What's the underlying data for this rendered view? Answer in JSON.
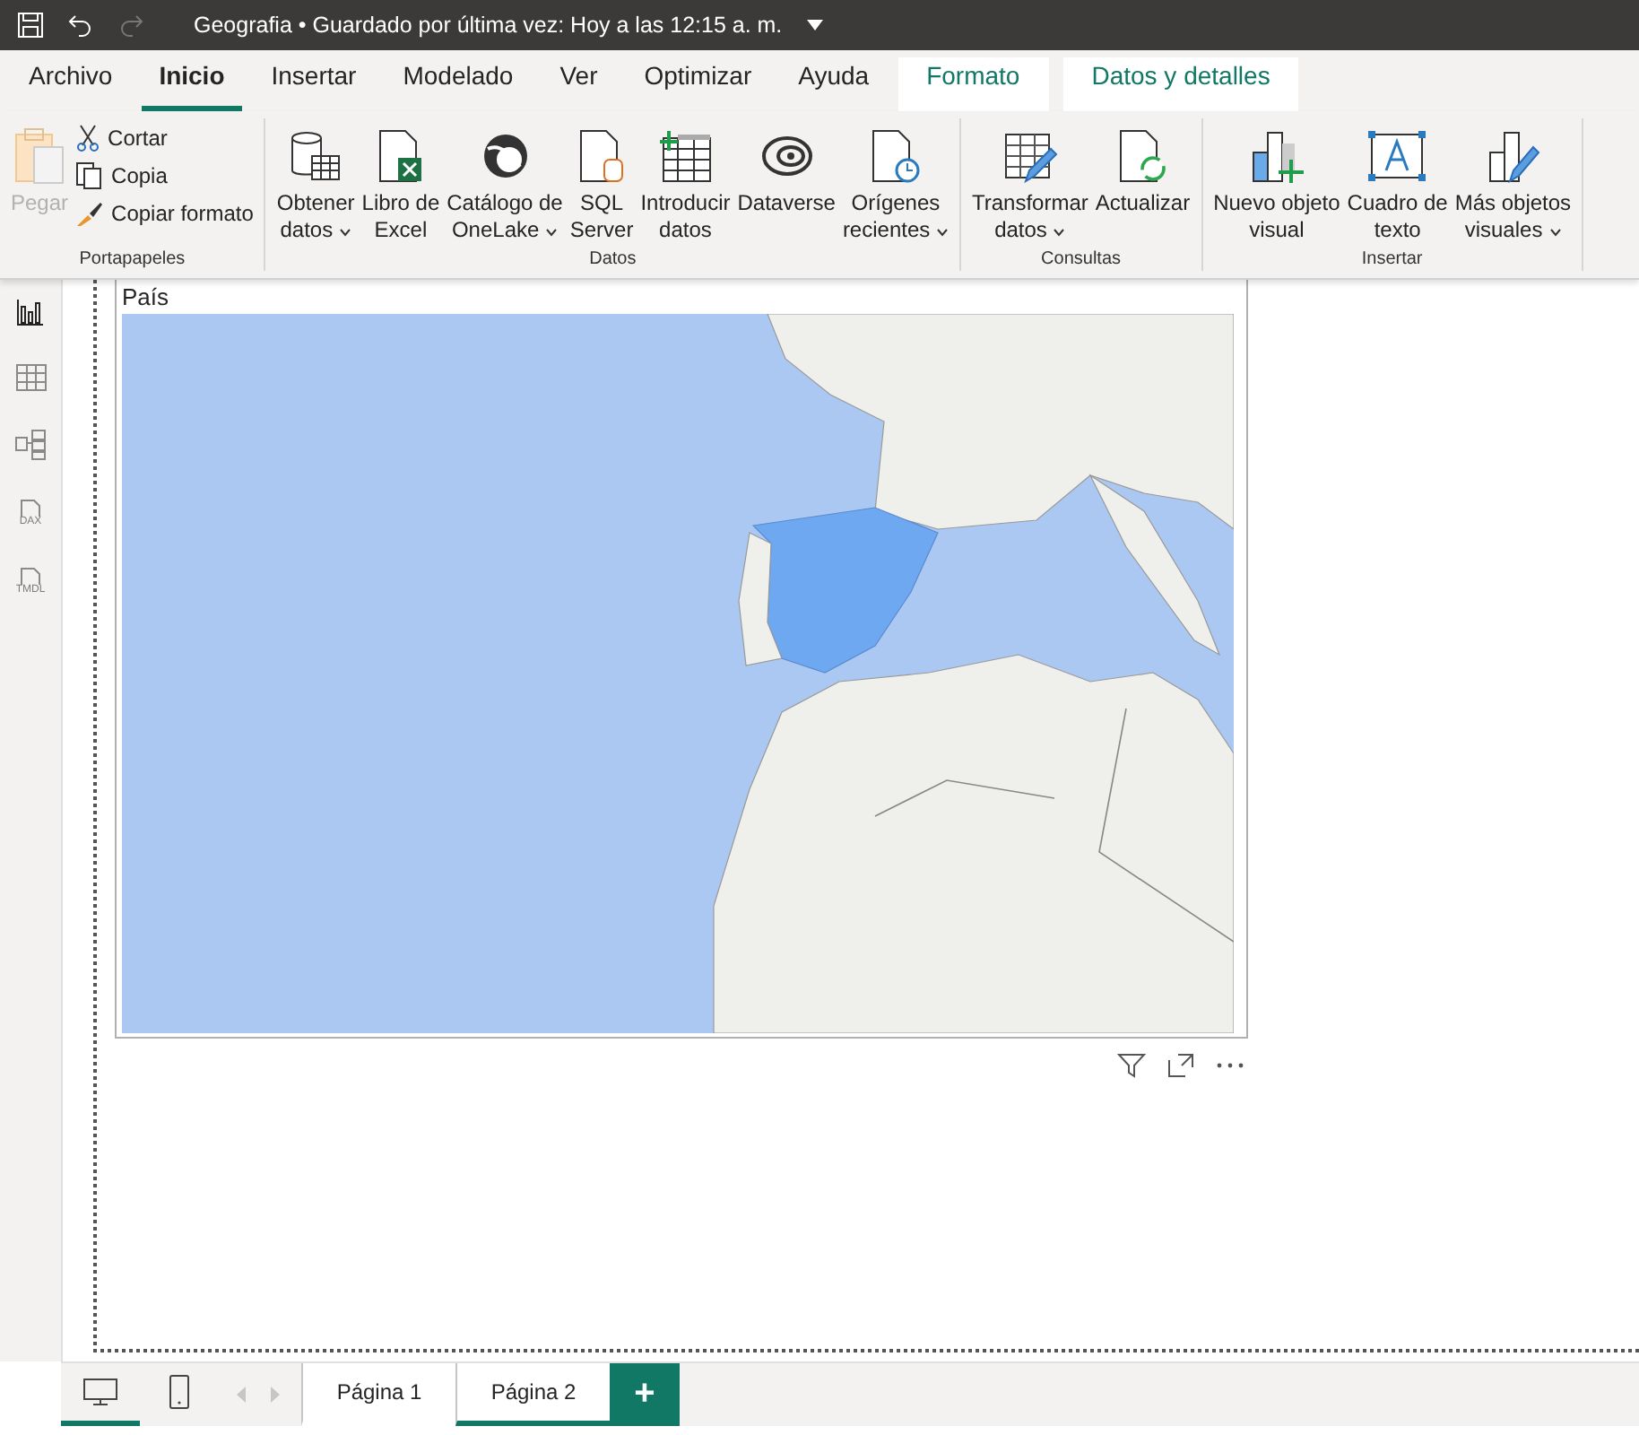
{
  "title_bar": {
    "title": "Geografia • Guardado por última vez: Hoy a las 12:15 a. m."
  },
  "tabs": [
    {
      "label": "Archivo",
      "selected": false,
      "kind": "normal"
    },
    {
      "label": "Inicio",
      "selected": true,
      "kind": "normal"
    },
    {
      "label": "Insertar",
      "selected": false,
      "kind": "normal"
    },
    {
      "label": "Modelado",
      "selected": false,
      "kind": "normal"
    },
    {
      "label": "Ver",
      "selected": false,
      "kind": "normal"
    },
    {
      "label": "Optimizar",
      "selected": false,
      "kind": "normal"
    },
    {
      "label": "Ayuda",
      "selected": false,
      "kind": "normal"
    },
    {
      "label": "Formato",
      "selected": false,
      "kind": "contextual"
    },
    {
      "label": "Datos y detalles",
      "selected": false,
      "kind": "contextual"
    }
  ],
  "ribbon": {
    "groups": [
      {
        "label": "Portapapeles",
        "items": [
          {
            "kind": "large",
            "lines": [
              "Pegar"
            ],
            "dropdown": false,
            "disabled": true
          },
          {
            "kind": "small",
            "lines": [
              "Cortar"
            ],
            "dropdown": false,
            "disabled": false
          },
          {
            "kind": "small",
            "lines": [
              "Copia"
            ],
            "dropdown": false,
            "disabled": false
          },
          {
            "kind": "small",
            "lines": [
              "Copiar formato"
            ],
            "dropdown": false,
            "disabled": false
          }
        ]
      },
      {
        "label": "Datos",
        "items": [
          {
            "kind": "large",
            "lines": [
              "Obtener",
              "datos"
            ],
            "dropdown": true,
            "disabled": false
          },
          {
            "kind": "large",
            "lines": [
              "Libro de",
              "Excel"
            ],
            "dropdown": false,
            "disabled": false
          },
          {
            "kind": "large",
            "lines": [
              "Catálogo de",
              "OneLake"
            ],
            "dropdown": true,
            "disabled": false
          },
          {
            "kind": "large",
            "lines": [
              "SQL",
              "Server"
            ],
            "dropdown": false,
            "disabled": false
          },
          {
            "kind": "large",
            "lines": [
              "Introducir",
              "datos"
            ],
            "dropdown": false,
            "disabled": false
          },
          {
            "kind": "large",
            "lines": [
              "Dataverse"
            ],
            "dropdown": false,
            "disabled": false
          },
          {
            "kind": "large",
            "lines": [
              "Orígenes",
              "recientes"
            ],
            "dropdown": true,
            "disabled": false
          }
        ]
      },
      {
        "label": "Consultas",
        "items": [
          {
            "kind": "large",
            "lines": [
              "Transformar",
              "datos"
            ],
            "dropdown": true,
            "disabled": false
          },
          {
            "kind": "large",
            "lines": [
              "Actualizar"
            ],
            "dropdown": false,
            "disabled": false
          }
        ]
      },
      {
        "label": "Insertar",
        "items": [
          {
            "kind": "large",
            "lines": [
              "Nuevo objeto",
              "visual"
            ],
            "dropdown": false,
            "disabled": false
          },
          {
            "kind": "large",
            "lines": [
              "Cuadro de",
              "texto"
            ],
            "dropdown": false,
            "disabled": false
          },
          {
            "kind": "large",
            "lines": [
              "Más objetos",
              "visuales"
            ],
            "dropdown": true,
            "disabled": false
          }
        ]
      }
    ]
  },
  "sidebar": {
    "items": [
      {
        "selected": true
      },
      {
        "selected": false
      },
      {
        "selected": false
      },
      {
        "selected": false,
        "label": "DAX"
      },
      {
        "selected": false,
        "label": "TMDL"
      }
    ]
  },
  "visual": {
    "title": "País"
  },
  "view_buttons": [
    {
      "selected": true
    },
    {
      "selected": false
    }
  ],
  "page_tabs": [
    {
      "label": "Página 1",
      "selected": false
    },
    {
      "label": "Página 2",
      "selected": true
    }
  ],
  "add_page": "+"
}
